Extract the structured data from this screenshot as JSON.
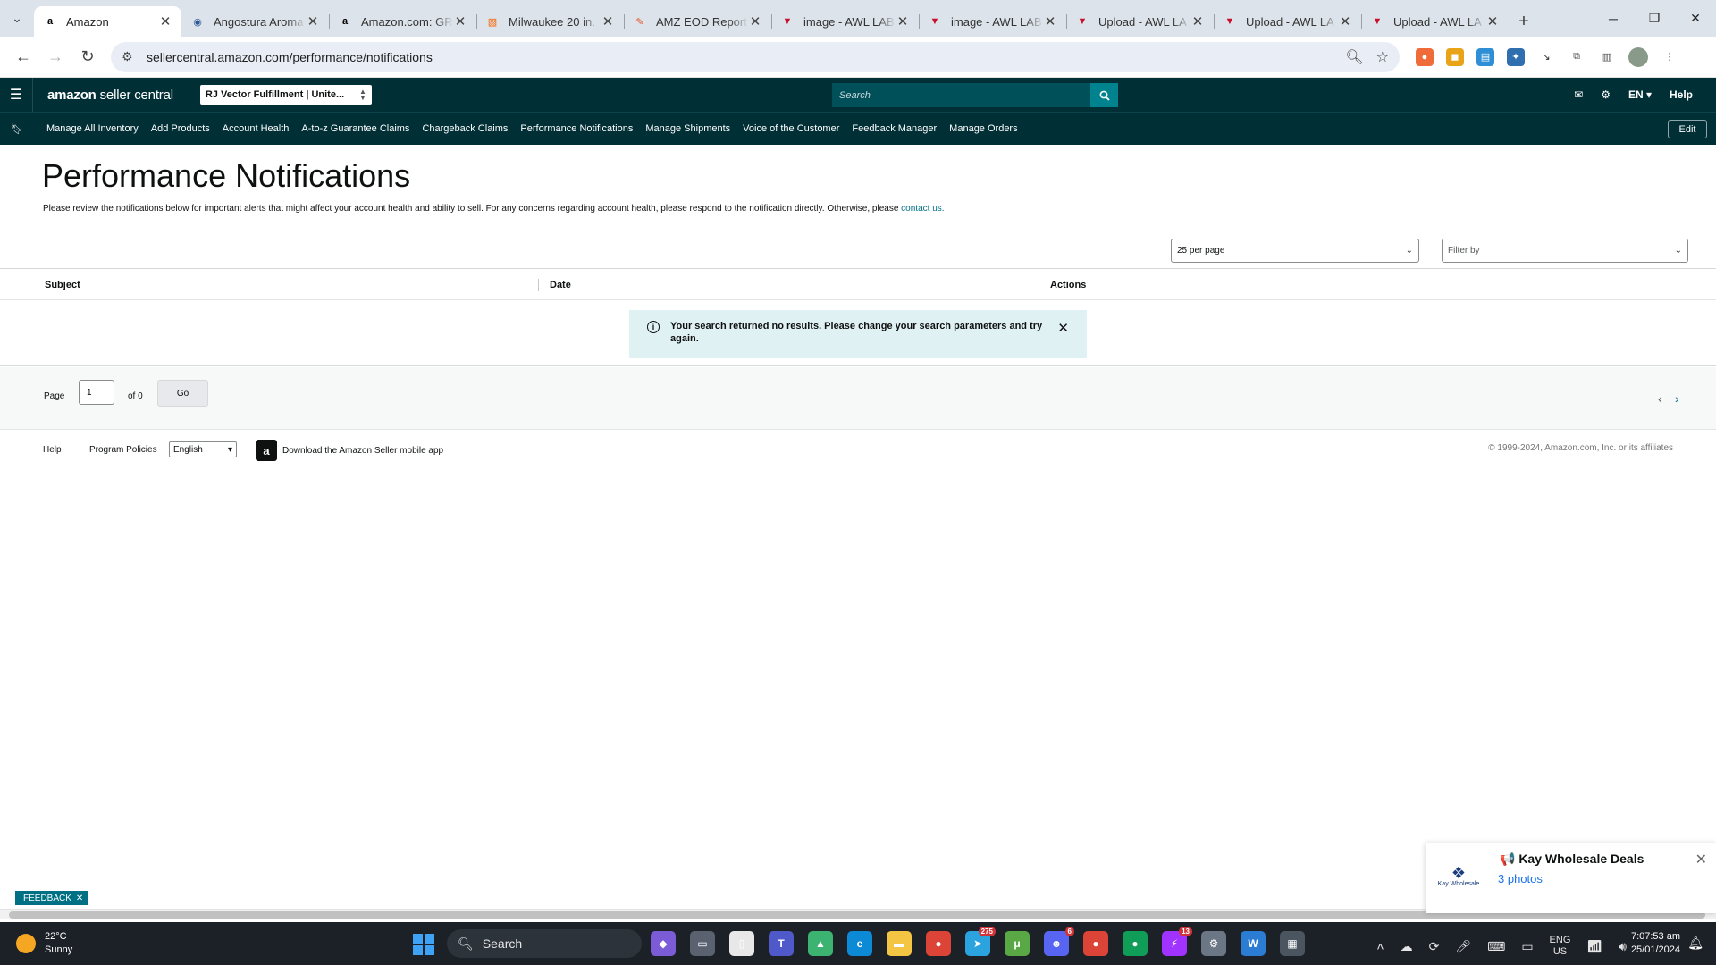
{
  "browser": {
    "tabs": [
      {
        "title": "Amazon",
        "favicon": "amazon-icon",
        "color": "#000000",
        "glyph": "a",
        "active": true
      },
      {
        "title": "Angostura Aroma",
        "favicon": "globe-icon",
        "color": "#2b5797",
        "glyph": "◉",
        "active": false
      },
      {
        "title": "Amazon.com: GR",
        "favicon": "amazon-icon",
        "color": "#000000",
        "glyph": "a",
        "active": false
      },
      {
        "title": "Milwaukee 20 in.",
        "favicon": "homedepot-icon",
        "color": "#f96302",
        "glyph": "▧",
        "active": false
      },
      {
        "title": "AMZ EOD Report",
        "favicon": "tool-icon",
        "color": "#e2572c",
        "glyph": "✎",
        "active": false
      },
      {
        "title": "image - AWL LAB",
        "favicon": "awl-icon",
        "color": "#c8102e",
        "glyph": "▼",
        "active": false
      },
      {
        "title": "image - AWL LAB",
        "favicon": "awl-icon",
        "color": "#c8102e",
        "glyph": "▼",
        "active": false
      },
      {
        "title": "Upload - AWL LA",
        "favicon": "awl-icon",
        "color": "#c8102e",
        "glyph": "▼",
        "active": false
      },
      {
        "title": "Upload - AWL LA",
        "favicon": "awl-icon",
        "color": "#c8102e",
        "glyph": "▼",
        "active": false
      },
      {
        "title": "Upload - AWL LA",
        "favicon": "awl-icon",
        "color": "#c8102e",
        "glyph": "▼",
        "active": false
      }
    ],
    "url": "sellercentral.amazon.com/performance/notifications"
  },
  "header": {
    "logo_main": "amazon",
    "logo_sub": "seller central",
    "account": "RJ Vector Fulfillment | Unite...",
    "search_placeholder": "Search",
    "language": "EN",
    "help": "Help"
  },
  "nav": {
    "items": [
      "Manage All Inventory",
      "Add Products",
      "Account Health",
      "A-to-z Guarantee Claims",
      "Chargeback Claims",
      "Performance Notifications",
      "Manage Shipments",
      "Voice of the Customer",
      "Feedback Manager",
      "Manage Orders"
    ],
    "edit": "Edit"
  },
  "main": {
    "title": "Performance Notifications",
    "description": "Please review the notifications below for important alerts that might affect your account health and ability to sell. For any concerns regarding account health, please respond to the notification directly. Otherwise, please",
    "contact_link": "contact us.",
    "per_page": "25 per page",
    "filter_placeholder": "Filter by",
    "columns": {
      "subject": "Subject",
      "date": "Date",
      "actions": "Actions"
    },
    "empty_message": "Your search returned no results. Please change your search parameters and try again."
  },
  "pager": {
    "label": "Page",
    "current": "1",
    "of": "of 0",
    "go": "Go"
  },
  "footer": {
    "help": "Help",
    "policies": "Program Policies",
    "language": "English",
    "app": "Download the Amazon Seller mobile app",
    "copyright": "© 1999-2024, Amazon.com, Inc. or its affiliates"
  },
  "feedback": "FEEDBACK",
  "notification": {
    "logo_text": "Kay Wholesale",
    "title": "📢 Kay Wholesale Deals",
    "subtitle": "3 photos"
  },
  "taskbar": {
    "temperature": "22°C",
    "weather": "Sunny",
    "search": "Search",
    "lang_top": "ENG",
    "lang_bottom": "US",
    "time": "7:07:53 am",
    "date": "25/01/2024",
    "apps": [
      {
        "name": "copilot-icon",
        "color": "#7b5cd6",
        "glyph": "◆",
        "badge": ""
      },
      {
        "name": "task-view-icon",
        "color": "#5a6270",
        "glyph": "▭",
        "badge": ""
      },
      {
        "name": "file-icon",
        "color": "#e8e8e8",
        "glyph": "▯",
        "badge": ""
      },
      {
        "name": "teams-icon",
        "color": "#5059c9",
        "glyph": "T",
        "badge": ""
      },
      {
        "name": "bluestacks-icon",
        "color": "#3cb371",
        "glyph": "▲",
        "badge": ""
      },
      {
        "name": "edge-icon",
        "color": "#0c8ad6",
        "glyph": "e",
        "badge": ""
      },
      {
        "name": "file-explorer-icon",
        "color": "#f4c542",
        "glyph": "▬",
        "badge": ""
      },
      {
        "name": "chrome-icon",
        "color": "#db4437",
        "glyph": "●",
        "badge": ""
      },
      {
        "name": "telegram-icon",
        "color": "#2aa3df",
        "glyph": "➤",
        "badge": "275"
      },
      {
        "name": "utorrent-icon",
        "color": "#5aa845",
        "glyph": "μ",
        "badge": ""
      },
      {
        "name": "discord-icon",
        "color": "#5865f2",
        "glyph": "☻",
        "badge": "6"
      },
      {
        "name": "chrome-profile-icon",
        "color": "#db4437",
        "glyph": "●",
        "badge": ""
      },
      {
        "name": "chrome-active-icon",
        "color": "#0f9d58",
        "glyph": "●",
        "badge": ""
      },
      {
        "name": "messenger-icon",
        "color": "#a033ff",
        "glyph": "⚡",
        "badge": "13"
      },
      {
        "name": "settings-icon",
        "color": "#6b7785",
        "glyph": "⚙",
        "badge": ""
      },
      {
        "name": "word-icon",
        "color": "#2b7cd3",
        "glyph": "W",
        "badge": ""
      },
      {
        "name": "calculator-icon",
        "color": "#4a5560",
        "glyph": "▦",
        "badge": ""
      }
    ]
  }
}
